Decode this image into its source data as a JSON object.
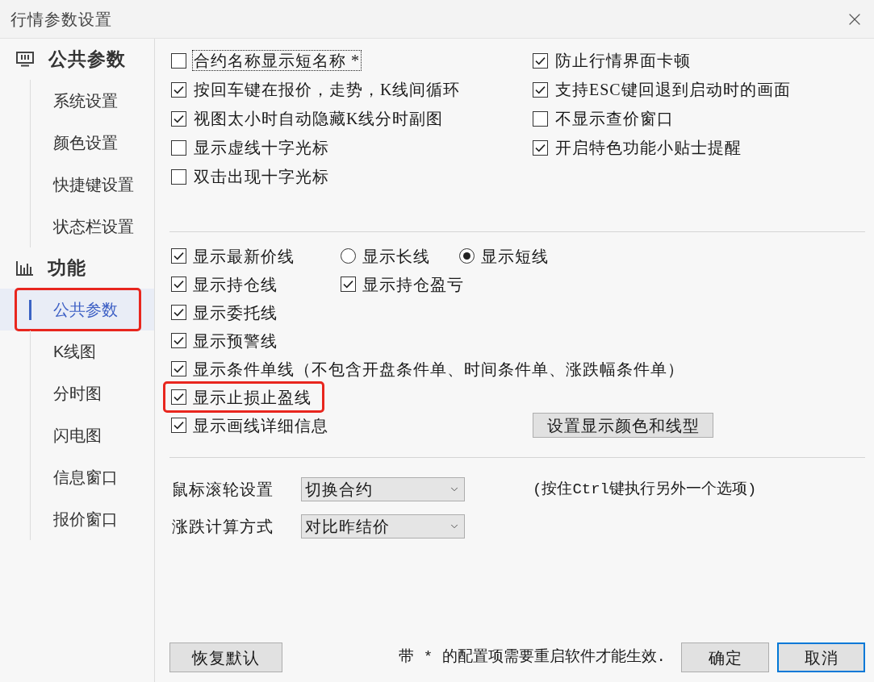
{
  "window": {
    "title": "行情参数设置"
  },
  "sidebar": {
    "groups": [
      {
        "label": "公共参数",
        "items": [
          {
            "label": "系统设置",
            "selected": false,
            "highlighted": false
          },
          {
            "label": "颜色设置",
            "selected": false,
            "highlighted": false
          },
          {
            "label": "快捷键设置",
            "selected": false,
            "highlighted": false
          },
          {
            "label": "状态栏设置",
            "selected": false,
            "highlighted": false
          }
        ]
      },
      {
        "label": "功能",
        "items": [
          {
            "label": "公共参数",
            "selected": true,
            "highlighted": true
          },
          {
            "label": "K线图",
            "selected": false,
            "highlighted": false
          },
          {
            "label": "分时图",
            "selected": false,
            "highlighted": false
          },
          {
            "label": "闪电图",
            "selected": false,
            "highlighted": false
          },
          {
            "label": "信息窗口",
            "selected": false,
            "highlighted": false
          },
          {
            "label": "报价窗口",
            "selected": false,
            "highlighted": false
          }
        ]
      }
    ]
  },
  "general_options": {
    "left": [
      {
        "label": "合约名称显示短名称 *",
        "checked": false,
        "focused": true
      },
      {
        "label": "按回车键在报价，走势，K线间循环",
        "checked": true,
        "focused": false
      },
      {
        "label": "视图太小时自动隐藏K线分时副图",
        "checked": true,
        "focused": false
      },
      {
        "label": "显示虚线十字光标",
        "checked": false,
        "focused": false
      },
      {
        "label": "双击出现十字光标",
        "checked": false,
        "focused": false
      }
    ],
    "right": [
      {
        "label": "防止行情界面卡顿",
        "checked": true,
        "focused": false
      },
      {
        "label": "支持ESC键回退到启动时的画面",
        "checked": true,
        "focused": false
      },
      {
        "label": "不显示查价窗口",
        "checked": false,
        "focused": false
      },
      {
        "label": "开启特色功能小贴士提醒",
        "checked": true,
        "focused": false
      }
    ]
  },
  "line_options": [
    {
      "highlighted": false,
      "items": [
        {
          "kind": "checkbox",
          "label": "显示最新价线",
          "checked": true
        },
        {
          "kind": "radio",
          "label": "显示长线",
          "selected": false
        },
        {
          "kind": "radio",
          "label": "显示短线",
          "selected": true
        }
      ]
    },
    {
      "highlighted": false,
      "items": [
        {
          "kind": "checkbox",
          "label": "显示持仓线",
          "checked": true
        },
        {
          "kind": "checkbox",
          "label": "显示持仓盈亏",
          "checked": true
        }
      ]
    },
    {
      "highlighted": false,
      "items": [
        {
          "kind": "checkbox",
          "label": "显示委托线",
          "checked": true
        }
      ]
    },
    {
      "highlighted": false,
      "items": [
        {
          "kind": "checkbox",
          "label": "显示预警线",
          "checked": true
        }
      ]
    },
    {
      "highlighted": false,
      "items": [
        {
          "kind": "checkbox",
          "label": "显示条件单线（不包含开盘条件单、时间条件单、涨跌幅条件单）",
          "checked": true
        }
      ]
    },
    {
      "highlighted": true,
      "items": [
        {
          "kind": "checkbox",
          "label": "显示止损止盈线",
          "checked": true
        }
      ]
    },
    {
      "highlighted": false,
      "items": [
        {
          "kind": "checkbox",
          "label": "显示画线详细信息",
          "checked": true
        },
        {
          "kind": "button",
          "label": "设置显示颜色和线型"
        }
      ]
    }
  ],
  "dropdowns": [
    {
      "label": "鼠标滚轮设置",
      "value": "切换合约"
    },
    {
      "label": "涨跌计算方式",
      "value": "对比昨结价"
    }
  ],
  "dropdown_hint": "(按住Ctrl键执行另外一个选项)",
  "footer": {
    "reset_button": "恢复默认",
    "note": "带 * 的配置项需要重启软件才能生效.",
    "buttons": [
      {
        "label": "确定",
        "default": false
      },
      {
        "label": "取消",
        "default": true
      }
    ]
  }
}
